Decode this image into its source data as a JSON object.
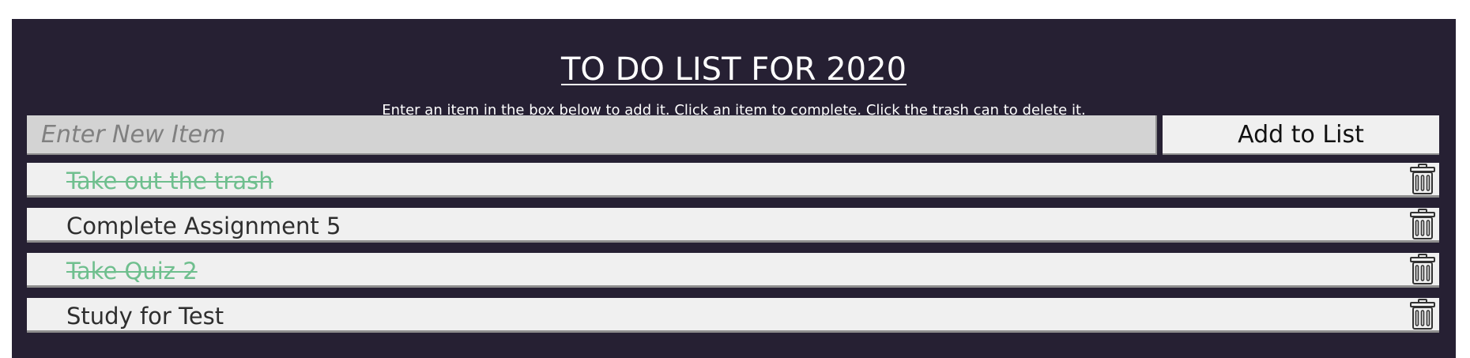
{
  "header": {
    "title": "TO DO LIST FOR 2020",
    "subtitle": "Enter an item in the box below to add it. Click an item to complete. Click the trash can to delete it."
  },
  "input": {
    "placeholder": "Enter New Item",
    "value": ""
  },
  "add_button": {
    "label": "Add to List"
  },
  "items": [
    {
      "text": "Take out the trash",
      "completed": true
    },
    {
      "text": "Complete Assignment 5",
      "completed": false
    },
    {
      "text": "Take Quiz 2",
      "completed": true
    },
    {
      "text": "Study for Test",
      "completed": false
    }
  ],
  "icons": {
    "delete": "trash-icon"
  },
  "colors": {
    "panel_background": "#262033",
    "item_background": "#f0f0f0",
    "input_background": "#d3d3d3",
    "completed_text": "#6fbf8e"
  }
}
